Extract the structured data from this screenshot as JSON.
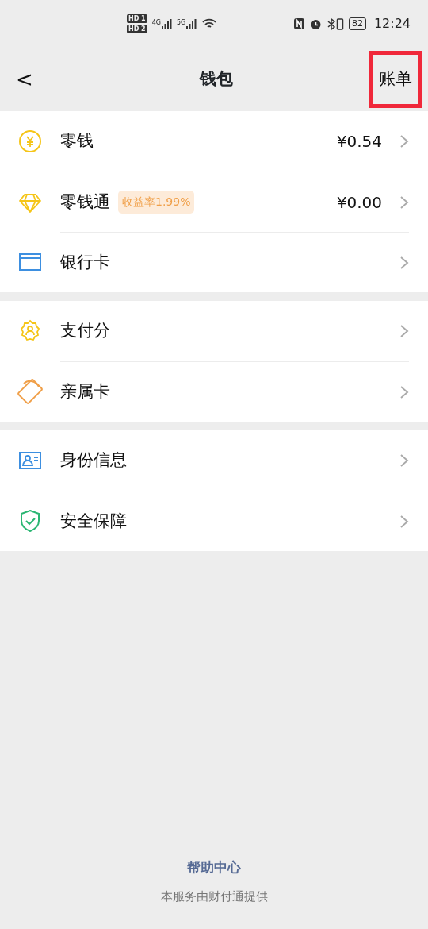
{
  "status_bar": {
    "sim_badges": [
      {
        "label": "HD",
        "slot": "1"
      },
      {
        "label": "HD",
        "slot": "2"
      }
    ],
    "networks": [
      "4G",
      "5G"
    ],
    "battery": "82",
    "time": "12:24"
  },
  "header": {
    "back": "<",
    "title": "钱包",
    "bill_button": {
      "label": "账单",
      "highlighted": true
    }
  },
  "groups": [
    {
      "items": [
        {
          "kind": "coin",
          "label": "零钱",
          "value": "¥0.54"
        },
        {
          "kind": "diamond",
          "label": "零钱通",
          "tag": "收益率1.99%",
          "value": "¥0.00"
        },
        {
          "kind": "card",
          "label": "银行卡"
        }
      ]
    },
    {
      "items": [
        {
          "kind": "score",
          "label": "支付分"
        },
        {
          "kind": "family",
          "label": "亲属卡"
        }
      ]
    },
    {
      "items": [
        {
          "kind": "id",
          "label": "身份信息"
        },
        {
          "kind": "shield",
          "label": "安全保障"
        }
      ]
    }
  ],
  "footer": {
    "link": "帮助中心",
    "note": "本服务由财付通提供"
  }
}
